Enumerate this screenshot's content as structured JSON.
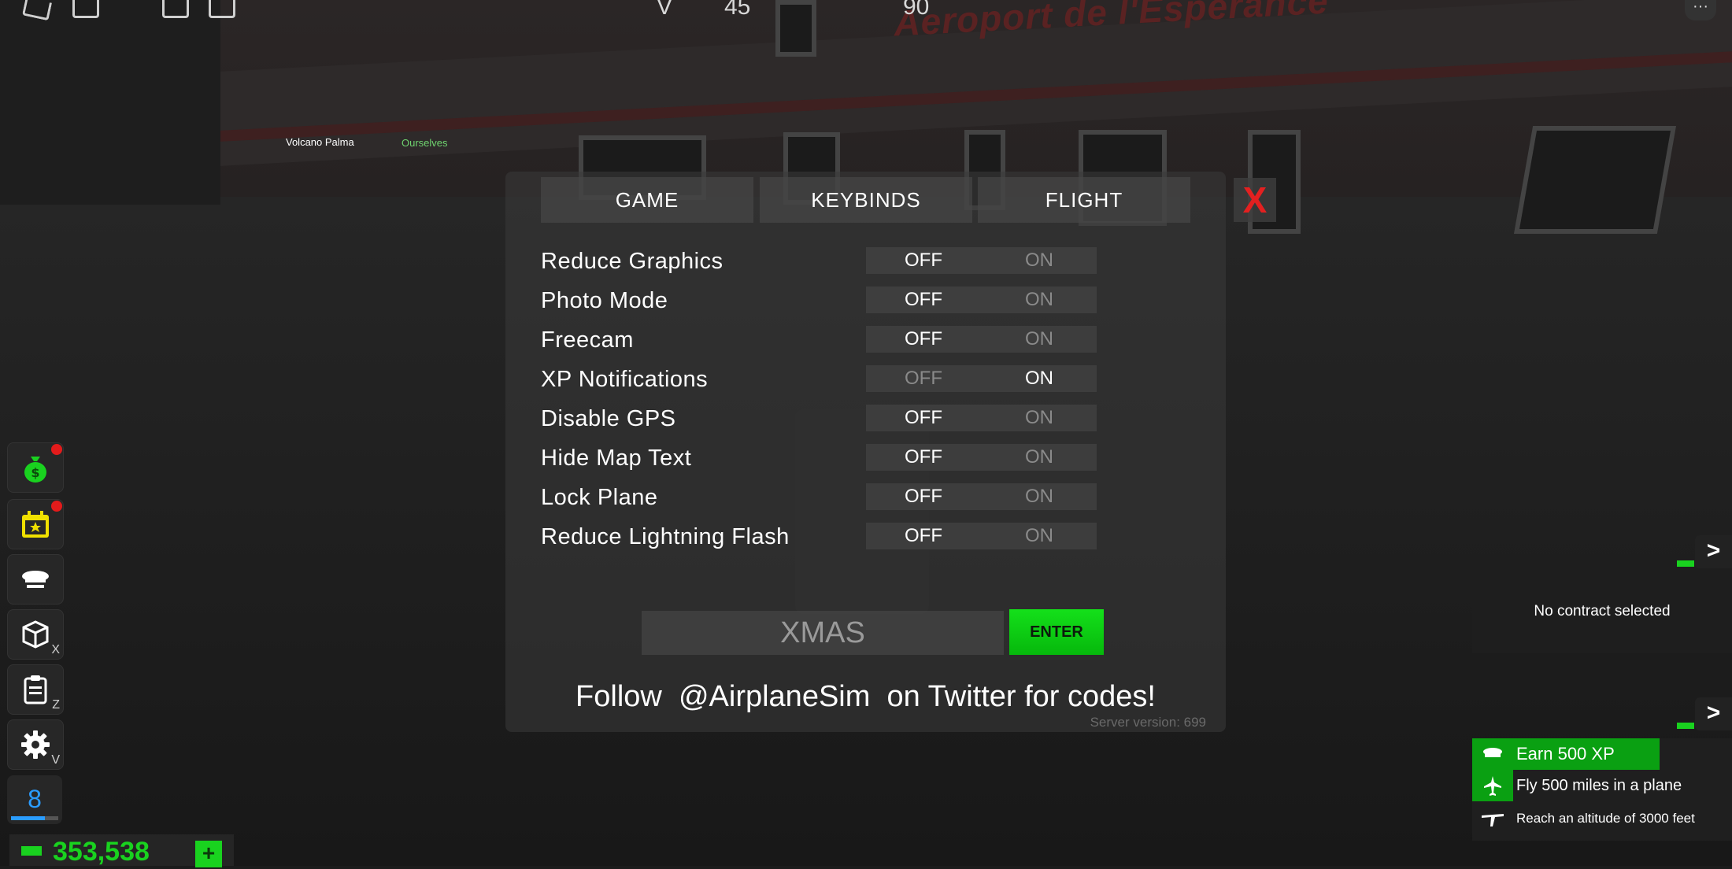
{
  "world": {
    "airport_sign": "Aeroport de l'Esperance",
    "label_volcano": "Volcano Palma",
    "label_player": "Ourselves",
    "top_v": "V",
    "top_45": "45",
    "top_90": "90",
    "menu": "···"
  },
  "settings": {
    "tabs": [
      "GAME",
      "KEYBINDS",
      "FLIGHT"
    ],
    "close": "X",
    "off_label": "OFF",
    "on_label": "ON",
    "rows": [
      {
        "label": "Reduce Graphics",
        "value": "OFF"
      },
      {
        "label": "Photo Mode",
        "value": "OFF"
      },
      {
        "label": "Freecam",
        "value": "OFF"
      },
      {
        "label": "XP Notifications",
        "value": "ON"
      },
      {
        "label": "Disable GPS",
        "value": "OFF"
      },
      {
        "label": "Hide Map Text",
        "value": "OFF"
      },
      {
        "label": "Lock Plane",
        "value": "OFF"
      },
      {
        "label": "Reduce Lightning Flash",
        "value": "OFF"
      }
    ],
    "code_input_value": "XMAS",
    "enter_label": "ENTER",
    "follow_text": "Follow  @AirplaneSim  on Twitter for codes!",
    "server_version": "Server version: 699"
  },
  "sidebar": {
    "hotkeys": {
      "inventory": "X",
      "clipboard": "Z",
      "settings": "V"
    },
    "level": "8",
    "level_progress": 0.72,
    "money": "353,538",
    "add_money": "+"
  },
  "right": {
    "expand": ">",
    "contract_text": "No contract selected",
    "quests": [
      {
        "text": "Earn 500 XP",
        "icon": "pilot-hat-icon"
      },
      {
        "text": "Fly 500 miles in a plane",
        "icon": "plane-icon"
      },
      {
        "text": "Reach an altitude of 3000 feet",
        "icon": "altitude-plane-icon"
      }
    ]
  },
  "colors": {
    "accent_green": "#19d21f",
    "close_red": "#e32020",
    "level_blue": "#2a9cff",
    "notification_red": "#e31b1b",
    "calendar_yellow": "#f0e000"
  }
}
